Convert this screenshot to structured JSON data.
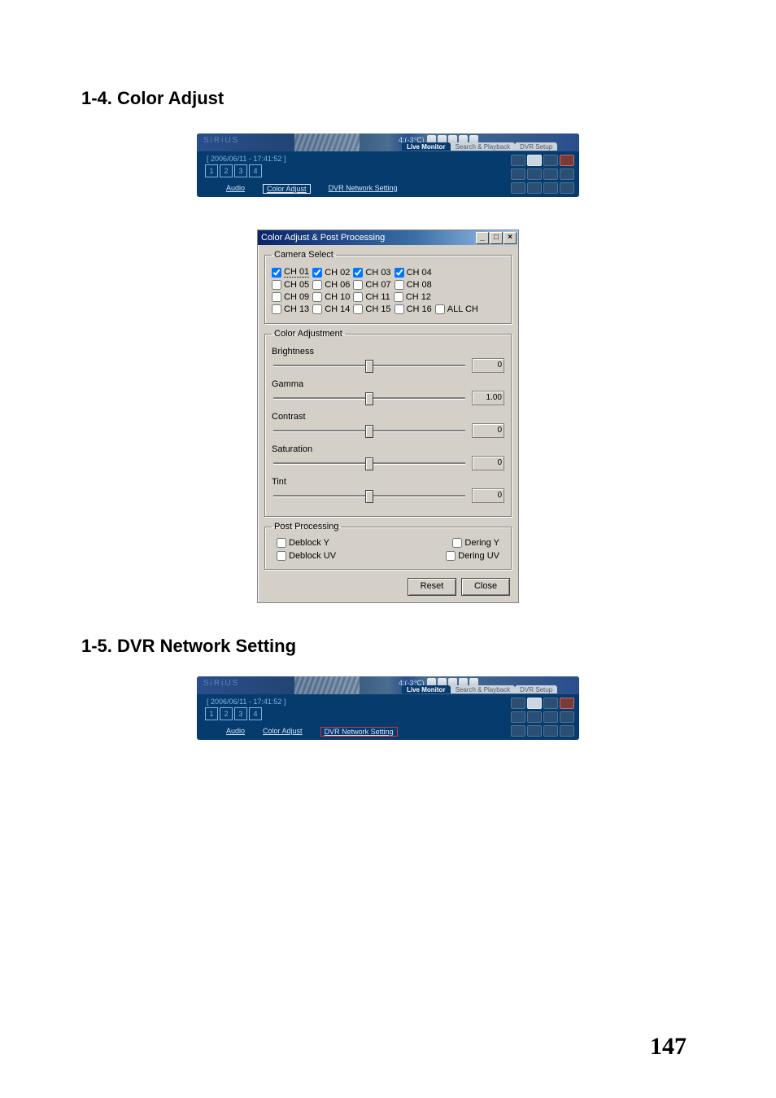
{
  "sections": {
    "s1": "1-4. Color Adjust",
    "s2": "1-5. DVR Network Setting"
  },
  "toolstrip": {
    "logo": "SiRiUS",
    "channel_label": "4:(-3℃)",
    "timestamp": "[ 2006/06/11 - 17:41:52 ]",
    "numbers": [
      "1",
      "2",
      "3",
      "4"
    ],
    "links": {
      "audio": "Audio",
      "color_adjust": "Color Adjust",
      "dvr_net": "DVR Network Setting"
    },
    "tabs": {
      "live": "Live Monitor",
      "search": "Search & Playback",
      "setup": "DVR Setup"
    }
  },
  "dialog": {
    "title": "Color Adjust & Post Processing",
    "camera_select": {
      "legend": "Camera Select",
      "rows": [
        [
          {
            "label": "CH 01",
            "checked": true,
            "dotted": true
          },
          {
            "label": "CH 02",
            "checked": true
          },
          {
            "label": "CH 03",
            "checked": true
          },
          {
            "label": "CH 04",
            "checked": true
          }
        ],
        [
          {
            "label": "CH 05",
            "checked": false
          },
          {
            "label": "CH 06",
            "checked": false
          },
          {
            "label": "CH 07",
            "checked": false
          },
          {
            "label": "CH 08",
            "checked": false
          }
        ],
        [
          {
            "label": "CH 09",
            "checked": false
          },
          {
            "label": "CH 10",
            "checked": false
          },
          {
            "label": "CH 11",
            "checked": false
          },
          {
            "label": "CH 12",
            "checked": false
          }
        ],
        [
          {
            "label": "CH 13",
            "checked": false
          },
          {
            "label": "CH 14",
            "checked": false
          },
          {
            "label": "CH 15",
            "checked": false
          },
          {
            "label": "CH 16",
            "checked": false
          },
          {
            "label": "ALL CH",
            "checked": false
          }
        ]
      ]
    },
    "color_adjustment": {
      "legend": "Color Adjustment",
      "sliders": [
        {
          "label": "Brightness",
          "value": "0",
          "pos": 50
        },
        {
          "label": "Gamma",
          "value": "1.00",
          "pos": 50
        },
        {
          "label": "Contrast",
          "value": "0",
          "pos": 50
        },
        {
          "label": "Saturation",
          "value": "0",
          "pos": 50
        },
        {
          "label": "Tint",
          "value": "0",
          "pos": 50
        }
      ]
    },
    "post_processing": {
      "legend": "Post Processing",
      "items": {
        "deblock_y": "Deblock Y",
        "dering_y": "Dering Y",
        "deblock_uv": "Deblock UV",
        "dering_uv": "Dering UV"
      }
    },
    "buttons": {
      "reset": "Reset",
      "close": "Close"
    }
  },
  "page_number": "147"
}
